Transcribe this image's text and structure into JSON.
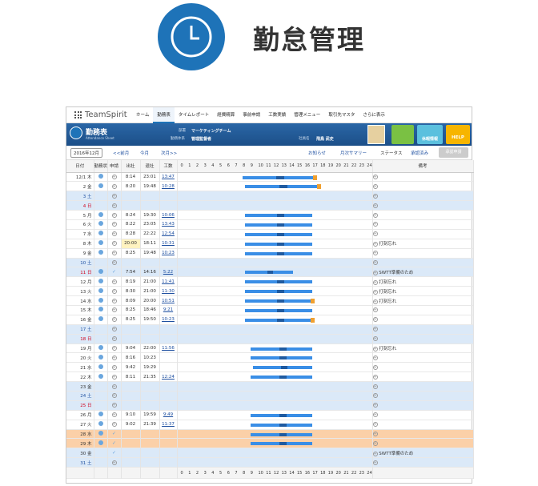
{
  "hero": {
    "title": "勤怠管理",
    "icon": "clock-icon"
  },
  "nav": {
    "logo": "TeamSpirit",
    "tabs": [
      "ホーム",
      "勤務表",
      "タイムレポート",
      "経費精算",
      "事前申請",
      "工数実績",
      "管理メニュー",
      "取引先マスタ"
    ],
    "more": "さらに表示"
  },
  "header": {
    "title": "勤務表",
    "subtitle": "Attendance Sheet",
    "dept_label": "部署",
    "dept": "マーケティングチーム",
    "system_label": "勤務体系",
    "system": "管理監督者",
    "emp_label": "社員名",
    "emp": "飛鳥 武史",
    "leave_btn": "休暇情報",
    "help_btn": "HELP"
  },
  "toolbar": {
    "month": "2016年12月",
    "prev": "<<前月",
    "cur": "今月",
    "next": "次月>>",
    "notice": "お知らせ",
    "summary": "月次サマリー",
    "status_label": "ステータス",
    "status": "承認済み",
    "approve_btn": "承認申請"
  },
  "columns": {
    "date": "日付",
    "status": "勤務状況",
    "req": "申請",
    "in": "出社",
    "out": "退社",
    "work": "工数",
    "note": "備考",
    "hours": [
      "0",
      "1",
      "2",
      "3",
      "4",
      "5",
      "6",
      "7",
      "8",
      "9",
      "10",
      "11",
      "12",
      "13",
      "14",
      "15",
      "16",
      "17",
      "18",
      "19",
      "20",
      "21",
      "22",
      "23",
      "24"
    ]
  },
  "rows": [
    {
      "d": "12/1",
      "w": "木",
      "t": "",
      "in": "8:14",
      "out": "23:01",
      "wk": "13:47",
      "s": "o",
      "note": "",
      "bar": [
        8,
        17.3
      ],
      "mk": 1
    },
    {
      "d": "2",
      "w": "金",
      "t": "",
      "in": "8:20",
      "out": "19:48",
      "wk": "10:28",
      "s": "o",
      "note": "",
      "bar": [
        8.3,
        17.8
      ],
      "mk": 1
    },
    {
      "d": "3",
      "w": "土",
      "t": "sat"
    },
    {
      "d": "4",
      "w": "日",
      "t": "sun"
    },
    {
      "d": "5",
      "w": "月",
      "in": "8:24",
      "out": "19:30",
      "wk": "10:06",
      "s": "o",
      "note": "",
      "bar": [
        8.3,
        17
      ]
    },
    {
      "d": "6",
      "w": "火",
      "in": "8:22",
      "out": "23:05",
      "wk": "13:43",
      "s": "o",
      "note": "",
      "bar": [
        8.3,
        17
      ]
    },
    {
      "d": "7",
      "w": "水",
      "in": "8:28",
      "out": "22:22",
      "wk": "12:54",
      "s": "o",
      "note": "",
      "bar": [
        8.3,
        17
      ]
    },
    {
      "d": "8",
      "w": "木",
      "in": "20:00",
      "out": "18:11",
      "wk": "10:31",
      "s": "o",
      "note": "打刻忘れ",
      "bar": [
        8.3,
        17
      ]
    },
    {
      "d": "9",
      "w": "金",
      "in": "8:25",
      "out": "19:48",
      "wk": "10:23",
      "s": "o",
      "note": "",
      "bar": [
        8.3,
        17
      ]
    },
    {
      "d": "10",
      "w": "土",
      "t": "sat"
    },
    {
      "d": "11",
      "w": "日",
      "t": "sun",
      "in": "7:54",
      "out": "14:16",
      "wk": "5:22",
      "s": "o",
      "c": 1,
      "note": "SWTT準備のため",
      "bar": [
        8.3,
        14.5
      ]
    },
    {
      "d": "12",
      "w": "月",
      "in": "8:19",
      "out": "21:00",
      "wk": "11:41",
      "s": "o",
      "note": "打刻忘れ",
      "bar": [
        8.3,
        17
      ]
    },
    {
      "d": "13",
      "w": "火",
      "in": "8:30",
      "out": "21:00",
      "wk": "11:30",
      "s": "o",
      "note": "打刻忘れ",
      "bar": [
        8.3,
        17
      ]
    },
    {
      "d": "14",
      "w": "水",
      "in": "8:09",
      "out": "20:00",
      "wk": "10:51",
      "s": "o",
      "note": "打刻忘れ",
      "bar": [
        8.3,
        17
      ],
      "mk": 1
    },
    {
      "d": "15",
      "w": "木",
      "in": "8:25",
      "out": "18:46",
      "wk": "9:21",
      "s": "o",
      "note": "",
      "bar": [
        8.3,
        17
      ]
    },
    {
      "d": "16",
      "w": "金",
      "in": "8:25",
      "out": "19:50",
      "wk": "10:23",
      "s": "o",
      "note": "",
      "bar": [
        8.3,
        17
      ],
      "mk": 1
    },
    {
      "d": "17",
      "w": "土",
      "t": "sat"
    },
    {
      "d": "18",
      "w": "日",
      "t": "sun"
    },
    {
      "d": "19",
      "w": "月",
      "in": "9:04",
      "out": "22:00",
      "wk": "11:56",
      "s": "o",
      "note": "打刻忘れ",
      "bar": [
        9,
        17
      ]
    },
    {
      "d": "20",
      "w": "火",
      "in": "8:16",
      "out": "10:23",
      "wk": "",
      "s": "o",
      "note": "",
      "bar": [
        9,
        17
      ]
    },
    {
      "d": "21",
      "w": "水",
      "in": "9:42",
      "out": "19:29",
      "wk": "",
      "s": "o",
      "note": "",
      "bar": [
        9.3,
        17
      ]
    },
    {
      "d": "22",
      "w": "木",
      "in": "8:11",
      "out": "21:35",
      "wk": "12:24",
      "s": "o",
      "note": "",
      "bar": [
        9,
        17
      ]
    },
    {
      "d": "23",
      "w": "金",
      "t": "sat"
    },
    {
      "d": "24",
      "w": "土",
      "t": "sat"
    },
    {
      "d": "25",
      "w": "日",
      "t": "sun"
    },
    {
      "d": "26",
      "w": "月",
      "in": "9:10",
      "out": "19:59",
      "wk": "9:49",
      "s": "o",
      "note": "",
      "bar": [
        9,
        17
      ]
    },
    {
      "d": "27",
      "w": "火",
      "in": "9:02",
      "out": "21:39",
      "wk": "11:37",
      "s": "o",
      "note": "",
      "bar": [
        9,
        17
      ]
    },
    {
      "d": "28",
      "w": "水",
      "t": "hl",
      "s": "o",
      "c": 1,
      "note": "",
      "bar": [
        9,
        17
      ]
    },
    {
      "d": "29",
      "w": "木",
      "t": "hl",
      "s": "o",
      "c": 1,
      "note": "",
      "bar": [
        9,
        17
      ]
    },
    {
      "d": "30",
      "w": "金",
      "t": "sat",
      "c": 1,
      "note": "SWTT準備のため"
    },
    {
      "d": "31",
      "w": "土",
      "t": "sat"
    }
  ]
}
